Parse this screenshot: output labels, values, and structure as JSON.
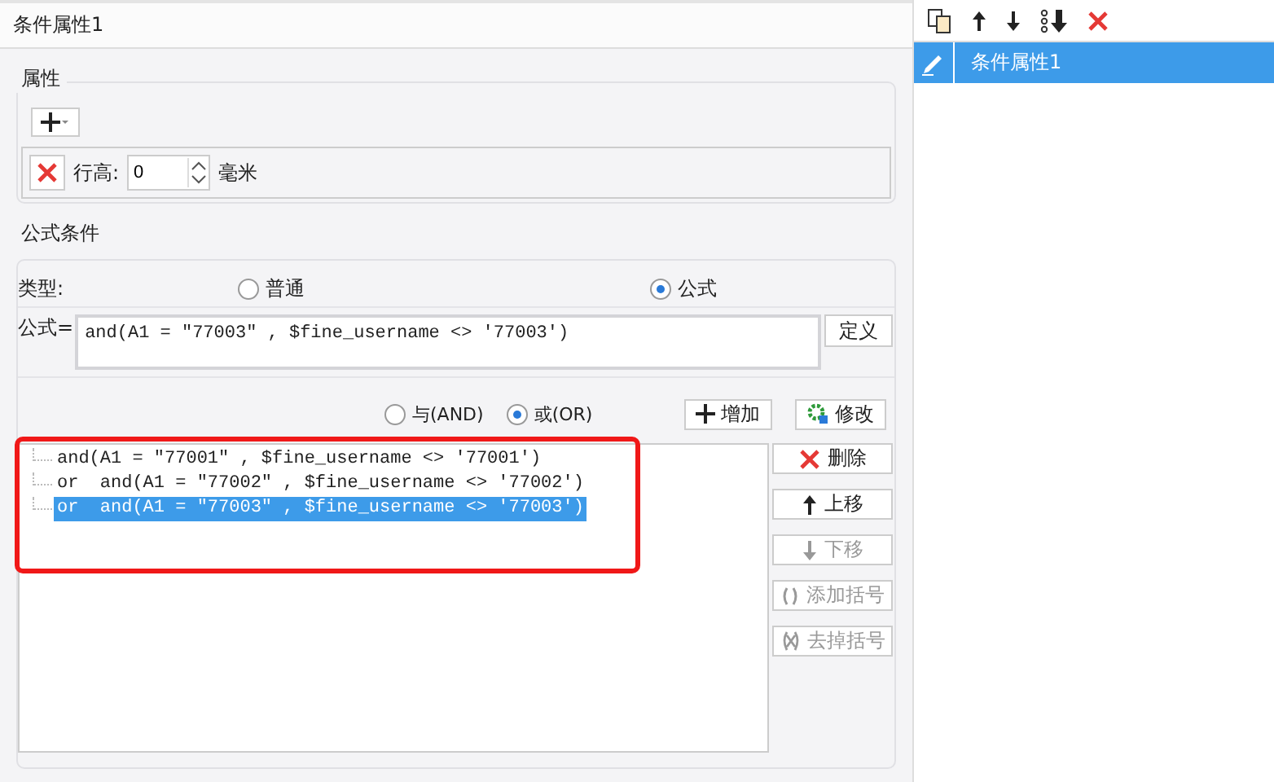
{
  "window": {
    "title": "条件属性1"
  },
  "properties": {
    "legend": "属性",
    "row": {
      "label": "行高:",
      "value": "0",
      "unit": "毫米"
    }
  },
  "formula_condition": {
    "legend": "公式条件",
    "type_label": "类型:",
    "type_options": [
      {
        "label": "普通",
        "selected": false
      },
      {
        "label": "公式",
        "selected": true
      }
    ],
    "formula_label": "公式=",
    "formula": "and(A1 = \"77003\" , $fine_username <> '77003')",
    "define_button": "定义",
    "logic_options": [
      {
        "label": "与(AND)",
        "selected": false
      },
      {
        "label": "或(OR)",
        "selected": true
      }
    ],
    "add_button": "增加",
    "modify_button": "修改",
    "conditions": [
      {
        "text": "and(A1 = \"77001\" , $fine_username <> '77001')",
        "selected": false
      },
      {
        "text": "or  and(A1 = \"77002\" , $fine_username <> '77002')",
        "selected": false
      },
      {
        "text": "or  and(A1 = \"77003\" , $fine_username <> '77003')",
        "selected": true
      }
    ],
    "side_buttons": [
      {
        "kind": "delete",
        "label": "删除",
        "disabled": false
      },
      {
        "kind": "up",
        "label": "上移",
        "disabled": false
      },
      {
        "kind": "down",
        "label": "下移",
        "disabled": true
      },
      {
        "kind": "add-paren",
        "label": "添加括号",
        "disabled": true
      },
      {
        "kind": "remove-paren",
        "label": "去掉括号",
        "disabled": true
      }
    ],
    "annotation": {
      "kind": "red-box"
    }
  },
  "side_panel": {
    "toolbar": [
      {
        "kind": "copy"
      },
      {
        "kind": "up"
      },
      {
        "kind": "down"
      },
      {
        "kind": "bottom"
      },
      {
        "kind": "delete"
      }
    ],
    "items": [
      {
        "label": "条件属性1",
        "selected": true
      }
    ]
  }
}
